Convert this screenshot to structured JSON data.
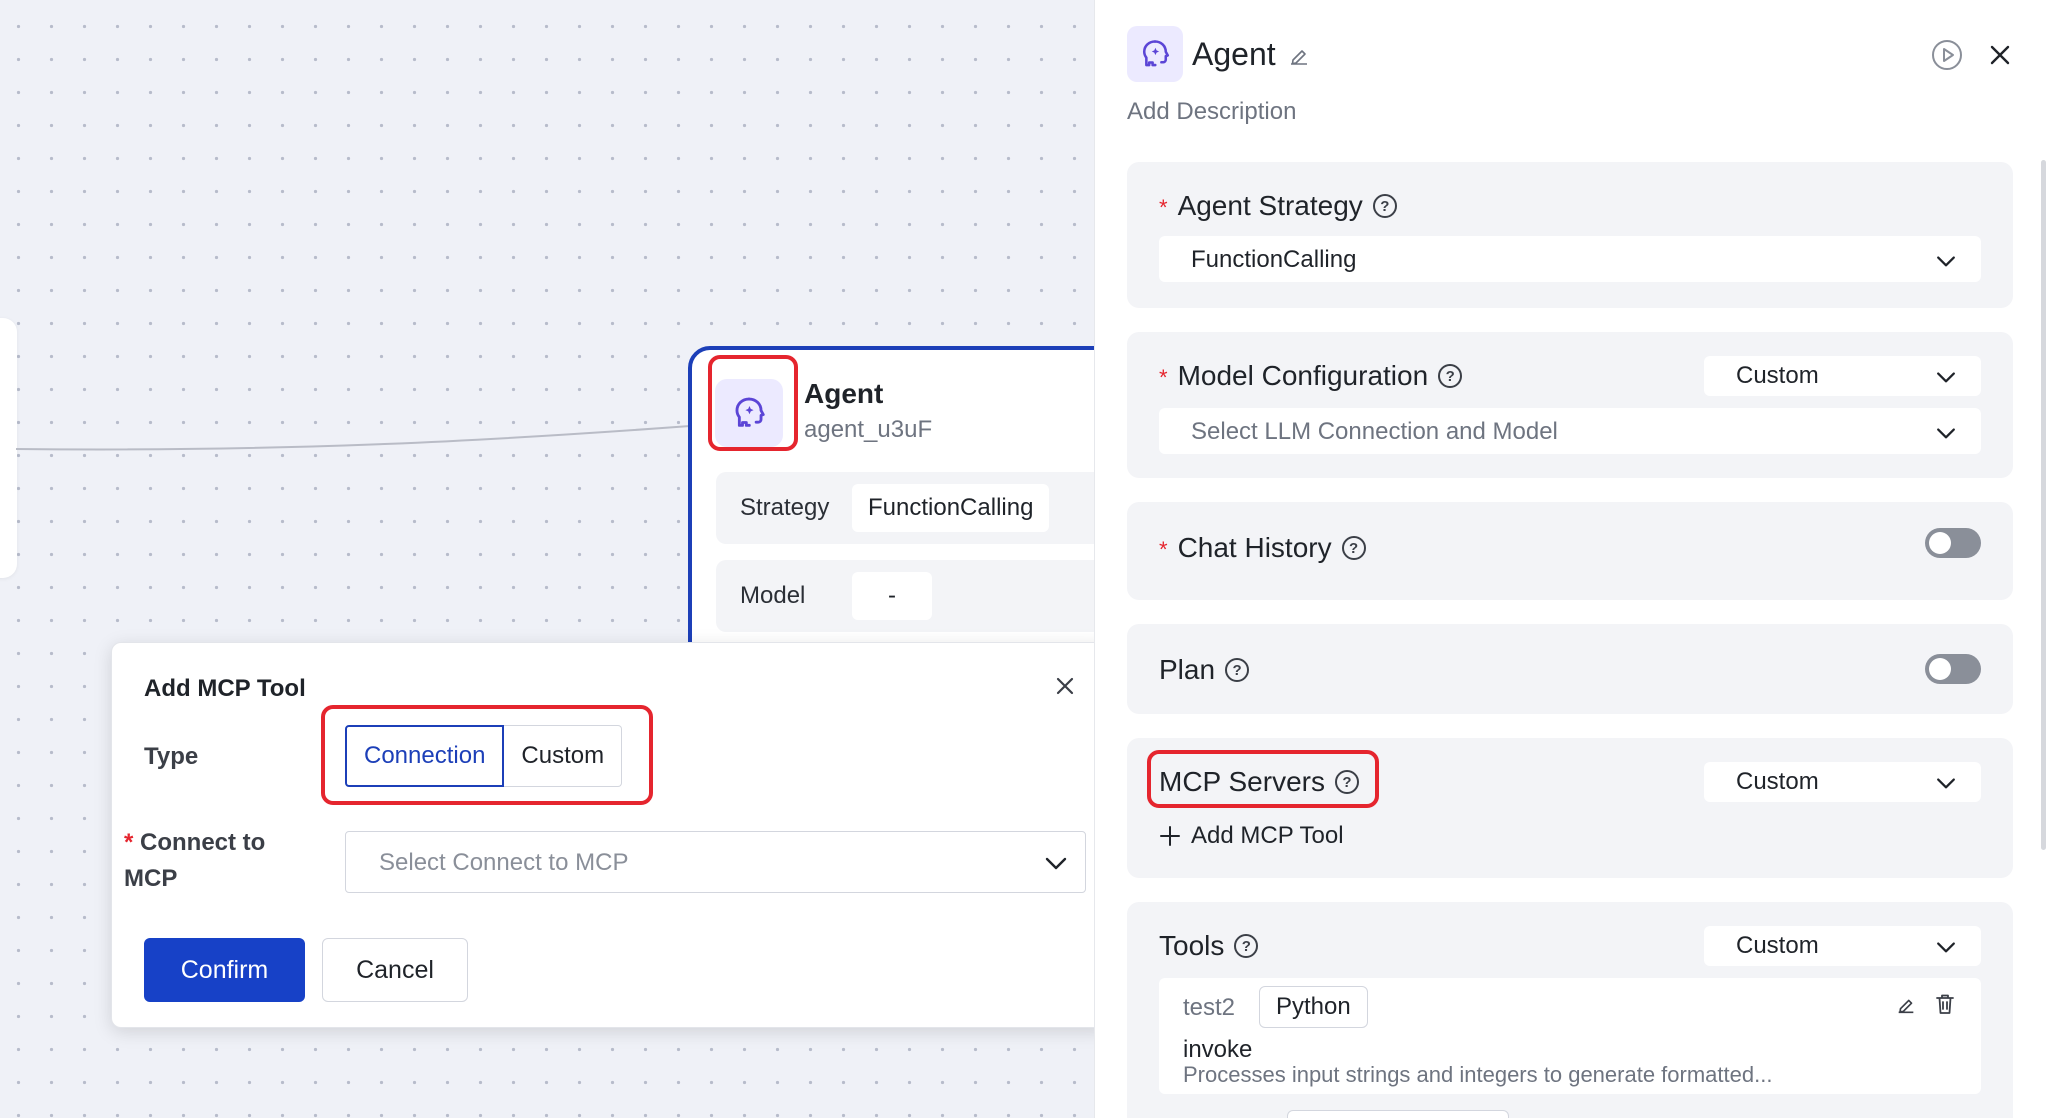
{
  "canvas": {
    "agent_node": {
      "title": "Agent",
      "id": "agent_u3uF",
      "strategy_label": "Strategy",
      "strategy_value": "FunctionCalling",
      "model_label": "Model",
      "model_value": "-"
    }
  },
  "dialog": {
    "title": "Add MCP Tool",
    "type_label": "Type",
    "type_options": [
      "Connection",
      "Custom"
    ],
    "type_selected": "Connection",
    "connect_label_line1": "Connect to",
    "connect_label_line2": "MCP",
    "connect_placeholder": "Select Connect to MCP",
    "confirm_label": "Confirm",
    "cancel_label": "Cancel"
  },
  "panel": {
    "title": "Agent",
    "description": "Add Description",
    "agent_strategy": {
      "label": "Agent Strategy",
      "value": "FunctionCalling"
    },
    "model_configuration": {
      "label": "Model Configuration",
      "mode": "Custom",
      "placeholder": "Select LLM Connection and Model"
    },
    "chat_history": {
      "label": "Chat History",
      "enabled": false
    },
    "plan": {
      "label": "Plan",
      "enabled": false
    },
    "mcp_servers": {
      "label": "MCP Servers",
      "mode": "Custom",
      "add_label": "Add MCP Tool"
    },
    "tools": {
      "label": "Tools",
      "mode": "Custom",
      "items": [
        {
          "name": "test2",
          "tag": "Python",
          "function": "invoke",
          "description": "Processes input strings and integers to generate formatted..."
        }
      ]
    }
  },
  "colors": {
    "accent": "#1c3fb8",
    "primary_button": "#1741c7",
    "highlight": "#e5252e",
    "agent_icon": "#5b45d6"
  }
}
